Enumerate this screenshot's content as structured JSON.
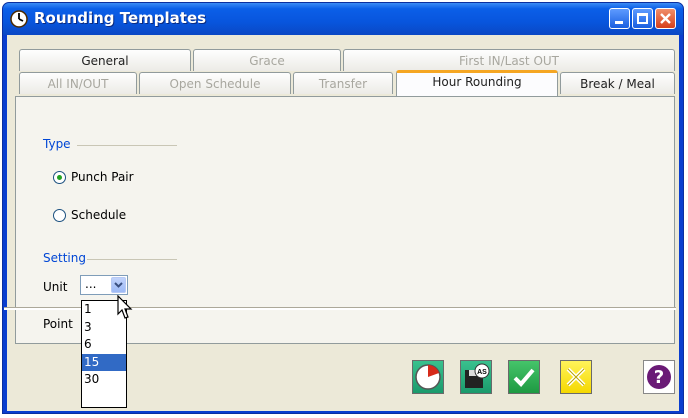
{
  "window": {
    "title": "Rounding Templates"
  },
  "titlebar_controls": [
    "minimize",
    "maximize",
    "close"
  ],
  "tabs": {
    "row1": [
      {
        "label": "General",
        "state": "normal"
      },
      {
        "label": "Grace",
        "state": "disabled"
      },
      {
        "label": "First IN/Last OUT",
        "state": "disabled"
      }
    ],
    "row2": [
      {
        "label": "All IN/OUT",
        "state": "disabled"
      },
      {
        "label": "Open Schedule",
        "state": "disabled"
      },
      {
        "label": "Transfer",
        "state": "disabled"
      },
      {
        "label": "Hour Rounding",
        "state": "active"
      },
      {
        "label": "Break / Meal",
        "state": "normal"
      }
    ]
  },
  "type_group": {
    "label": "Type",
    "options": [
      {
        "label": "Punch Pair",
        "checked": true
      },
      {
        "label": "Schedule",
        "checked": false
      }
    ]
  },
  "setting_group": {
    "label": "Setting",
    "unit_label": "Unit",
    "unit_value": "...",
    "point_label": "Point",
    "unit_options": [
      "1",
      "3",
      "6",
      "15",
      "30"
    ],
    "unit_highlighted": "15"
  },
  "toolbar": {
    "buttons": [
      "clock-icon",
      "save-as-icon",
      "ok-check-icon",
      "cancel-x-icon",
      "help-icon"
    ]
  },
  "colors": {
    "titlebar": "#0855dd",
    "client_bg": "#ece9d8",
    "group_label": "#0046d5",
    "tab_active_accent": "#f5a623",
    "selection": "#316ac5",
    "ok_green": "#2aa84a",
    "cancel_yellow": "#ffe900",
    "help_purple": "#6a1a76"
  }
}
